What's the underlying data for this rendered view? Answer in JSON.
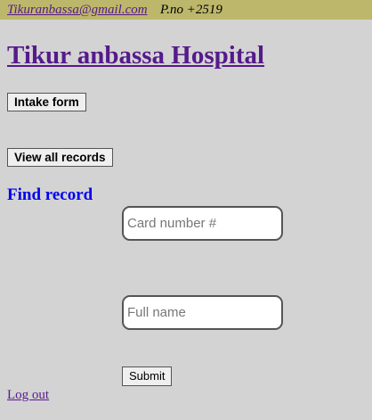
{
  "header": {
    "email": "Tikuranbassa@gmail.com",
    "phone": "P.no  +2519"
  },
  "hospital": {
    "title": "Tikur anbassa Hospital"
  },
  "actions": {
    "intake_label": "Intake form",
    "view_all_label": "View all records"
  },
  "find_record": {
    "heading": "Find record",
    "card_number": {
      "value": "",
      "placeholder": "Card number #"
    },
    "full_name": {
      "value": "",
      "placeholder": "Full name"
    },
    "submit_label": "Submit"
  },
  "footer": {
    "logout_label": "Log out"
  },
  "colors": {
    "page_background": "#d3d3d3",
    "header_bar": "#bdb76b",
    "visited_link": "#551a8b",
    "heading_blue": "#0000ee"
  }
}
